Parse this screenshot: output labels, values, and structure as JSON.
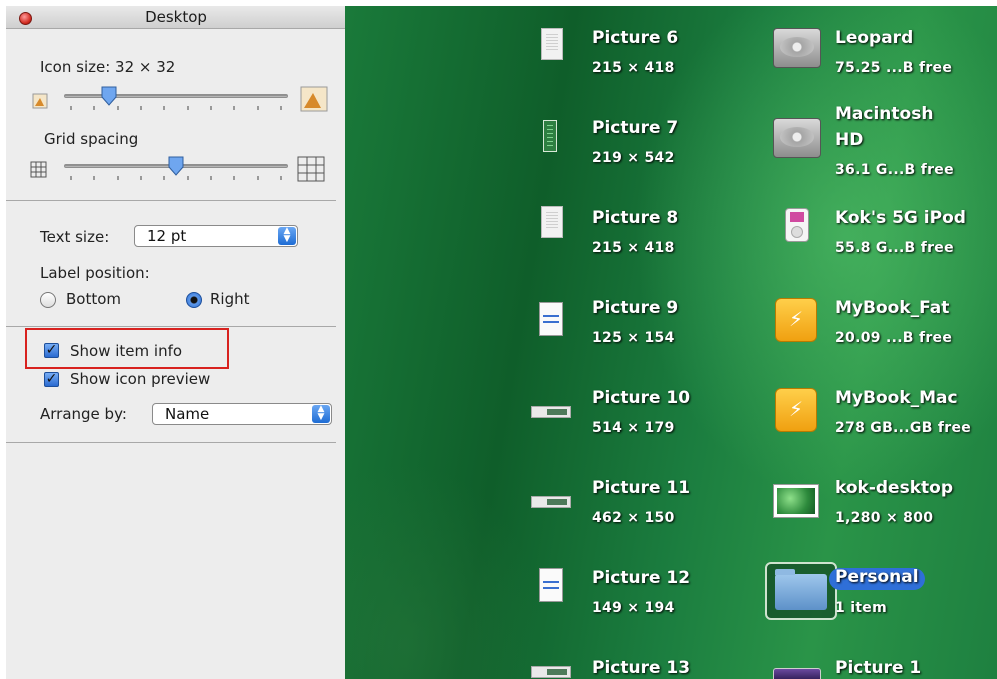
{
  "window": {
    "title": "Desktop"
  },
  "icon_size": {
    "label": "Icon size: 32 × 32",
    "slider_value_fraction": 0.2
  },
  "grid_spacing": {
    "label": "Grid spacing",
    "slider_value_fraction": 0.5
  },
  "text_size": {
    "label": "Text size:",
    "value": "12 pt"
  },
  "label_position": {
    "label": "Label position:",
    "options": [
      {
        "label": "Bottom",
        "selected": false
      },
      {
        "label": "Right",
        "selected": true
      }
    ]
  },
  "checkboxes": [
    {
      "label": "Show item info",
      "checked": true
    },
    {
      "label": "Show icon preview",
      "checked": true
    }
  ],
  "arrange_by": {
    "label": "Arrange by:",
    "value": "Name"
  },
  "desktop": {
    "left_column": [
      {
        "name": "Picture 6",
        "info": "215 × 418",
        "icon": "document-icon"
      },
      {
        "name": "Picture 7",
        "info": "219 × 542",
        "icon": "tall-image-icon"
      },
      {
        "name": "Picture 8",
        "info": "215 × 418",
        "icon": "document-icon"
      },
      {
        "name": "Picture 9",
        "info": "125 × 154",
        "icon": "dialog-image-icon"
      },
      {
        "name": "Picture 10",
        "info": "514 × 179",
        "icon": "wide-image-icon"
      },
      {
        "name": "Picture 11",
        "info": "462 × 150",
        "icon": "wide-image-icon"
      },
      {
        "name": "Picture 12",
        "info": "149 × 194",
        "icon": "dialog-image-icon"
      },
      {
        "name": "Picture 13",
        "info": "",
        "icon": "wide-image-icon"
      }
    ],
    "right_column": [
      {
        "name": "Leopard",
        "info": "75.25 ...B free",
        "icon": "hard-drive-icon"
      },
      {
        "name": "Macintosh",
        "name2": "HD",
        "info": "36.1 G...B free",
        "icon": "hard-drive-icon"
      },
      {
        "name": "Kok's 5G iPod",
        "info": "55.8 G...B free",
        "icon": "ipod-icon"
      },
      {
        "name": "MyBook_Fat",
        "info": "20.09 ...B free",
        "icon": "external-drive-icon"
      },
      {
        "name": "MyBook_Mac",
        "info": "278 GB...GB free",
        "icon": "external-drive-icon"
      },
      {
        "name": "kok-desktop",
        "info": "1,280 × 800",
        "icon": "photo-icon"
      },
      {
        "name": "Personal",
        "info": "1 item",
        "icon": "folder-icon",
        "selected": true
      },
      {
        "name": "Picture 1",
        "info": "",
        "icon": "purple-image-icon"
      }
    ]
  },
  "colors": {
    "selection_blue": "#2f6fd8",
    "highlight_red": "#d8221f",
    "desktop_green": "#1a7a3a"
  }
}
